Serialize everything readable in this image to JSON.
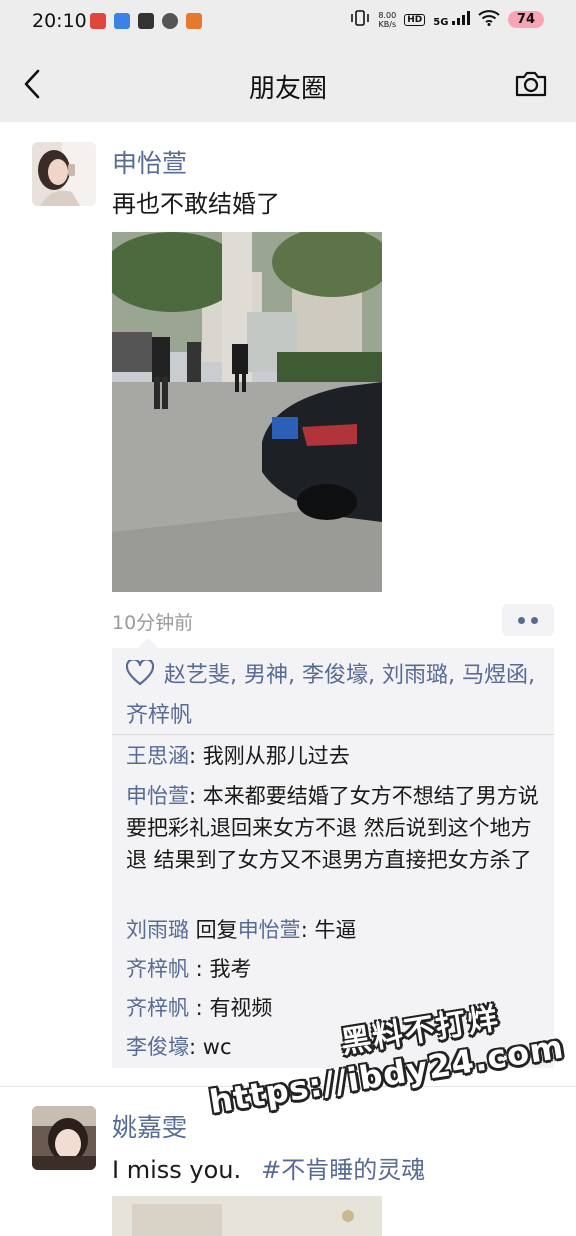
{
  "status_bar": {
    "time": "20:10",
    "net_speed_value": "8.00",
    "net_speed_unit": "KB/s",
    "hd": "HD",
    "signal": "5G",
    "battery": "74"
  },
  "nav": {
    "title": "朋友圈"
  },
  "post1": {
    "author": "申怡萱",
    "text": "再也不敢结婚了",
    "time": "10分钟前",
    "likes": "赵艺斐, 男神, 李俊壕, 刘雨璐, 马煜函, 齐梓帆",
    "comments": [
      {
        "name": "王思涵",
        "sep": ": ",
        "text": "我刚从那儿过去"
      },
      {
        "name": "申怡萱",
        "sep": ": ",
        "text": "本来都要结婚了女方不想结了男方说要把彩礼退回来女方不退 然后说到这个地方退 结果到了女方又不退男方直接把女方杀了"
      },
      {
        "name": "刘雨璐",
        "reply_word": " 回复",
        "reply_to": "申怡萱",
        "sep": ": ",
        "text": "牛逼"
      },
      {
        "name": "齐梓帆",
        "sep": " : ",
        "text": "我考"
      },
      {
        "name": "齐梓帆",
        "sep": " : ",
        "text": "有视频"
      },
      {
        "name": "李俊壕",
        "sep": ": ",
        "text": "wc"
      }
    ]
  },
  "post2": {
    "author": "姚嘉雯",
    "text": "I miss you.",
    "hashtag": "#不肯睡的灵魂"
  },
  "watermark": {
    "line1": "黑料不打烊",
    "line2": "https://ibdy24.com"
  }
}
